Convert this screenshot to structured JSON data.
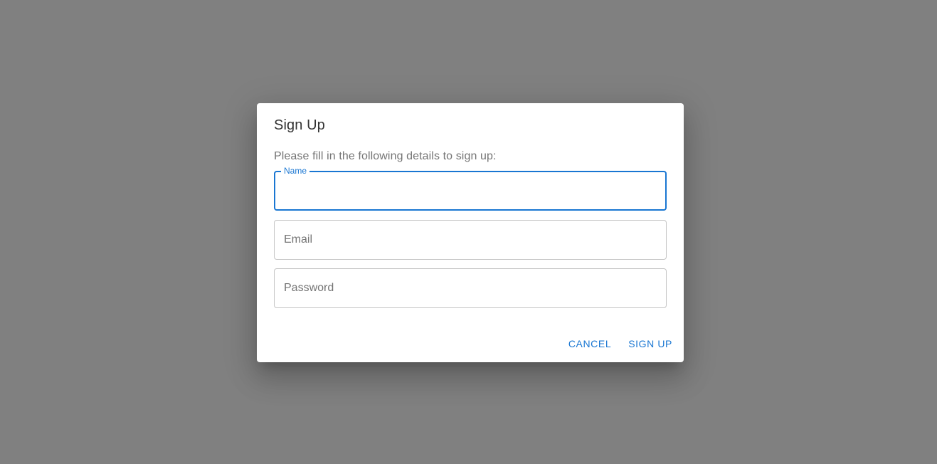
{
  "dialog": {
    "title": "Sign Up",
    "description": "Please fill in the following details to sign up:",
    "fields": {
      "name": {
        "label": "Name",
        "value": "",
        "placeholder": ""
      },
      "email": {
        "value": "",
        "placeholder": "Email"
      },
      "password": {
        "value": "",
        "placeholder": "Password"
      }
    },
    "actions": {
      "cancel_label": "CANCEL",
      "signup_label": "SIGN UP"
    }
  },
  "colors": {
    "backdrop": "#808080",
    "accent": "#1976d2",
    "surface": "#ffffff",
    "border": "#c4c4c4"
  }
}
